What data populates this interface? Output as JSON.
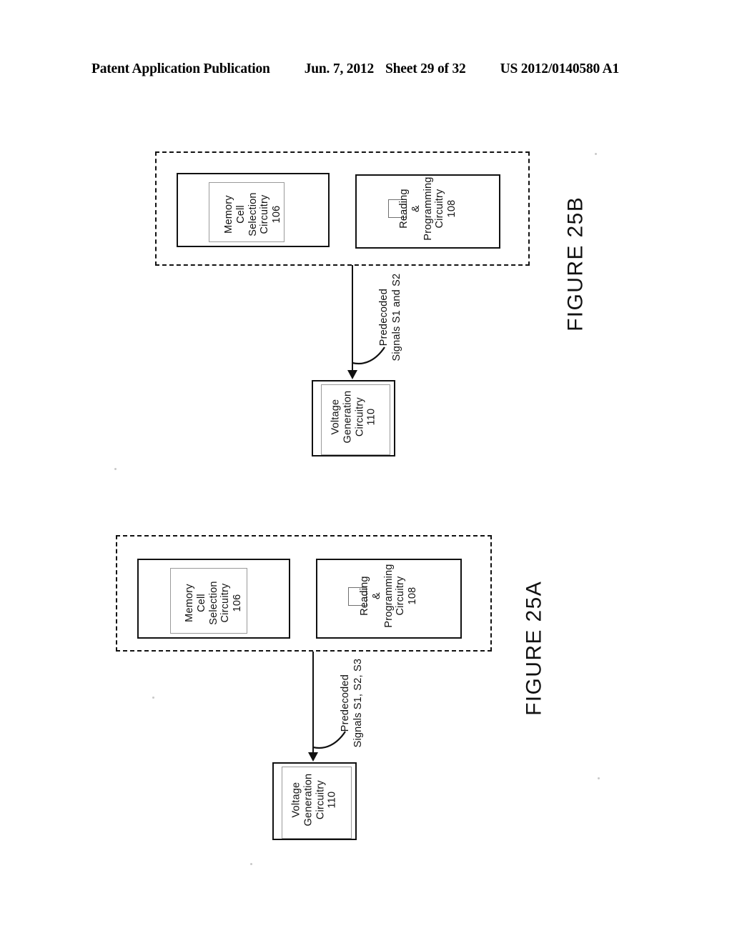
{
  "header": {
    "title": "Patent Application Publication",
    "date": "Jun. 7, 2012",
    "sheet": "Sheet 29 of 32",
    "publication_number": "US 2012/0140580 A1"
  },
  "figures": [
    {
      "id": "fig-25b",
      "caption": "FIGURE 25B",
      "blocks": [
        {
          "name": "memory-cell-selection-circuitry",
          "lines": [
            "Memory",
            "Cell",
            "Selection",
            "Circuitry"
          ],
          "reference_numeral": "106",
          "text": "Memory\nCell\nSelection\nCircuitry\n106"
        },
        {
          "name": "reading-and-programming-circuitry",
          "lines": [
            "Reading",
            "&",
            "Programming",
            "Circuitry"
          ],
          "reference_numeral": "108",
          "text": "Reading\n&\nProgramming\nCircuitry\n108"
        },
        {
          "name": "voltage-generation-circuitry",
          "lines": [
            "Voltage",
            "Generation",
            "Circuitry"
          ],
          "reference_numeral": "110",
          "text": "Voltage\nGeneration\nCircuitry\n110"
        }
      ],
      "connector": {
        "name": "predecoded-signals-connector",
        "label_line1": "Predecoded",
        "label_line2": "Signals S1 and S2",
        "text": "Predecoded\nSignals S1 and S2"
      }
    },
    {
      "id": "fig-25a",
      "caption": "FIGURE 25A",
      "blocks": [
        {
          "name": "memory-cell-selection-circuitry",
          "lines": [
            "Memory",
            "Cell",
            "Selection",
            "Circuitry"
          ],
          "reference_numeral": "106",
          "text": "Memory\nCell\nSelection\nCircuitry\n106"
        },
        {
          "name": "reading-and-programming-circuitry",
          "lines": [
            "Reading",
            "&",
            "Programming",
            "Circuitry"
          ],
          "reference_numeral": "108",
          "text": "Reading\n&\nProgramming\nCircuitry\n108"
        },
        {
          "name": "voltage-generation-circuitry",
          "lines": [
            "Voltage",
            "Generation",
            "Circuitry"
          ],
          "reference_numeral": "110",
          "text": "Voltage\nGeneration\nCircuitry\n110"
        }
      ],
      "connector": {
        "name": "predecoded-signals-connector",
        "label_line1": "Predecoded",
        "label_line2": "Signals S1, S2, S3",
        "text": "Predecoded\nSignals S1, S2, S3"
      }
    }
  ],
  "colors": {
    "ink": "#111111",
    "paper": "#ffffff",
    "faint_rule": "#9a9a9a"
  }
}
